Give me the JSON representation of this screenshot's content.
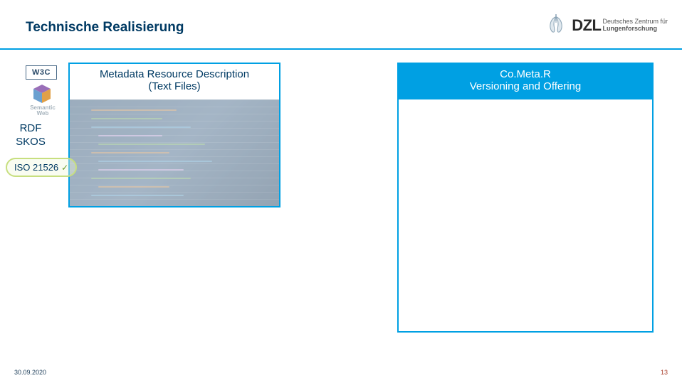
{
  "header": {
    "title": "Technische Realisierung",
    "logo": {
      "abbr": "DZL",
      "line1": "Deutsches Zentrum für",
      "line2": "Lungenforschung"
    }
  },
  "leftPanel": {
    "line1": "Metadata Resource Description",
    "line2": "(Text Files)"
  },
  "rightPanel": {
    "line1": "Co.Meta.R",
    "line2": "Versioning and Offering"
  },
  "sidebar": {
    "w3c": "W3C",
    "semanticWeb": "Semantic Web",
    "rdf": "RDF",
    "skos": "SKOS",
    "iso": "ISO 21526",
    "check": "✓"
  },
  "footer": {
    "date": "30.09.2020",
    "page": "13"
  }
}
